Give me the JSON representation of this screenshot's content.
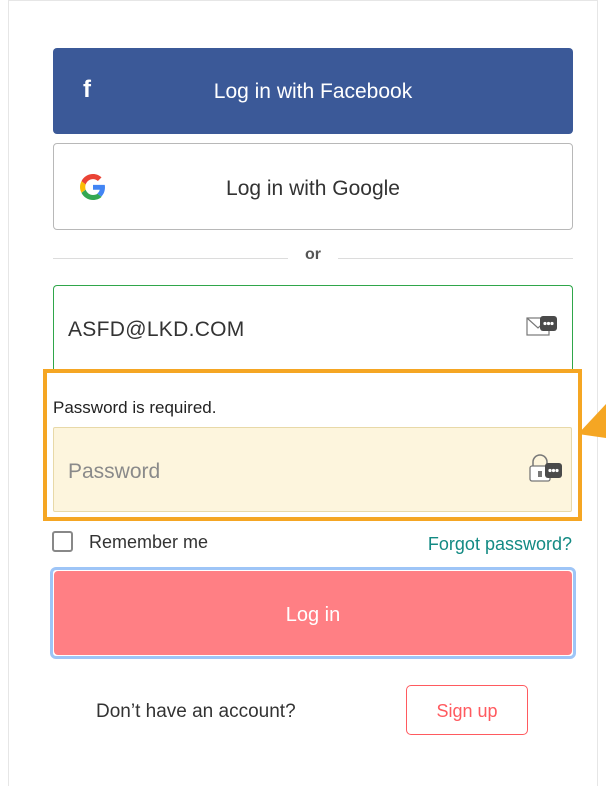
{
  "social": {
    "facebook_label": "Log in with Facebook",
    "facebook_glyph": "f",
    "google_label": "Log in with Google"
  },
  "divider": {
    "text": "or"
  },
  "email": {
    "value": "ASFD@LKD.COM",
    "icon": "mail-icon"
  },
  "password": {
    "error": "Password is required.",
    "placeholder": "Password",
    "icon": "lock-icon"
  },
  "options": {
    "remember_label": "Remember me",
    "forgot_label": "Forgot password?"
  },
  "login": {
    "label": "Log in"
  },
  "signup": {
    "prompt": "Don’t have an account?",
    "label": "Sign up"
  },
  "colors": {
    "facebook": "#3b5998",
    "login": "#ff7f84",
    "success_border": "#2fa64a",
    "highlight": "#f5a623",
    "link": "#138a83",
    "signup": "#ff5a5f"
  }
}
